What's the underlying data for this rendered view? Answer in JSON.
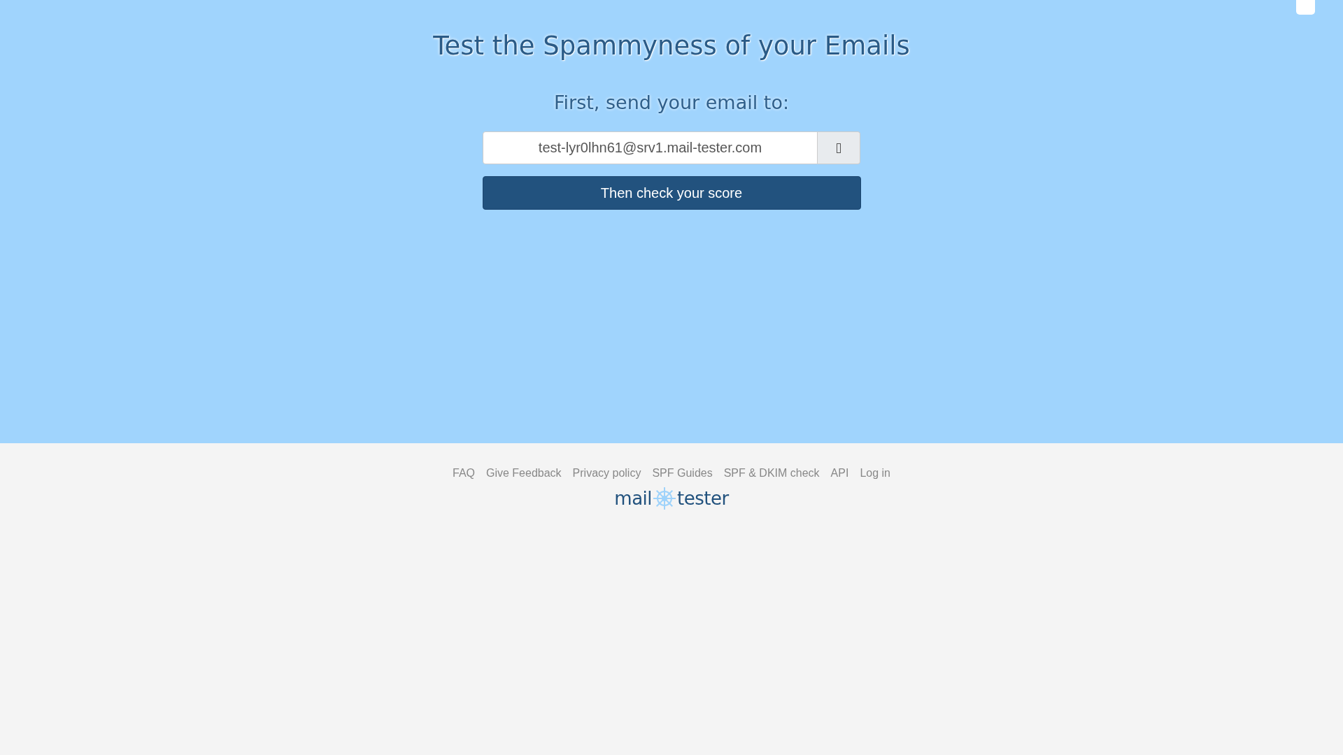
{
  "hero": {
    "title": "Test the Spammyness of your Emails",
    "subtitle": "First, send your email to:",
    "email_field": {
      "value": "test-lyr0lhn61@srv1.mail-tester.com"
    },
    "check_button": "Then check your score"
  },
  "footer": {
    "links": [
      "FAQ",
      "Give Feedback",
      "Privacy policy",
      "SPF Guides",
      "SPF & DKIM check",
      "API",
      "Log in"
    ],
    "logo": {
      "left": "mail",
      "right": "tester"
    }
  }
}
